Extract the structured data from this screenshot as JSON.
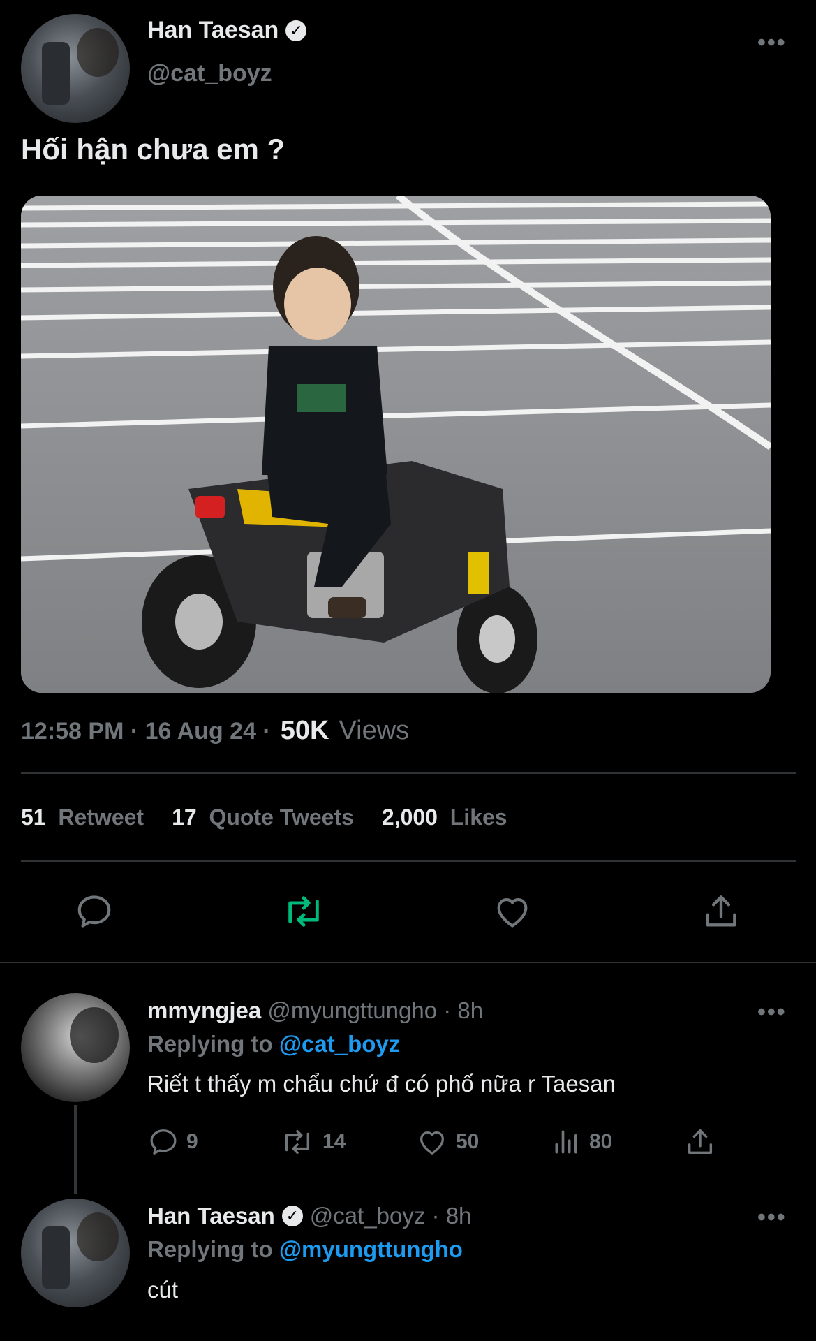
{
  "tweet": {
    "author_name": "Han Taesan",
    "author_handle": "@cat_boyz",
    "text": "Hối hận chưa em ?",
    "time": "12:58 PM · 16 Aug 24 ·",
    "views_count": "50K",
    "views_label": "Views",
    "retweets_count": "51",
    "retweets_label": "Retweet",
    "quotes_count": "17",
    "quotes_label": "Quote Tweets",
    "likes_count": "2,000",
    "likes_label": "Likes",
    "more": "•••"
  },
  "replies": [
    {
      "name": "mmyngjea",
      "handle_time": "@myungttungho · 8h",
      "replying_prefix": "Replying to",
      "replying_to": "@cat_boyz",
      "text": "Riết t thấy m chẩu chứ đ có phố nữa r Taesan",
      "reply_count": "9",
      "retweet_count": "14",
      "like_count": "50",
      "views_count": "80",
      "more": "•••"
    },
    {
      "name": "Han Taesan",
      "handle_time": "@cat_boyz · 8h",
      "replying_prefix": "Replying to",
      "replying_to": "@myungttungho",
      "text": "cút",
      "more": "•••"
    }
  ],
  "colors": {
    "background": "#000000",
    "text": "#e7e9ea",
    "muted": "#71767b",
    "link": "#1d9bf0",
    "retweet_active": "#00ba7c",
    "divider": "#2f3336"
  }
}
